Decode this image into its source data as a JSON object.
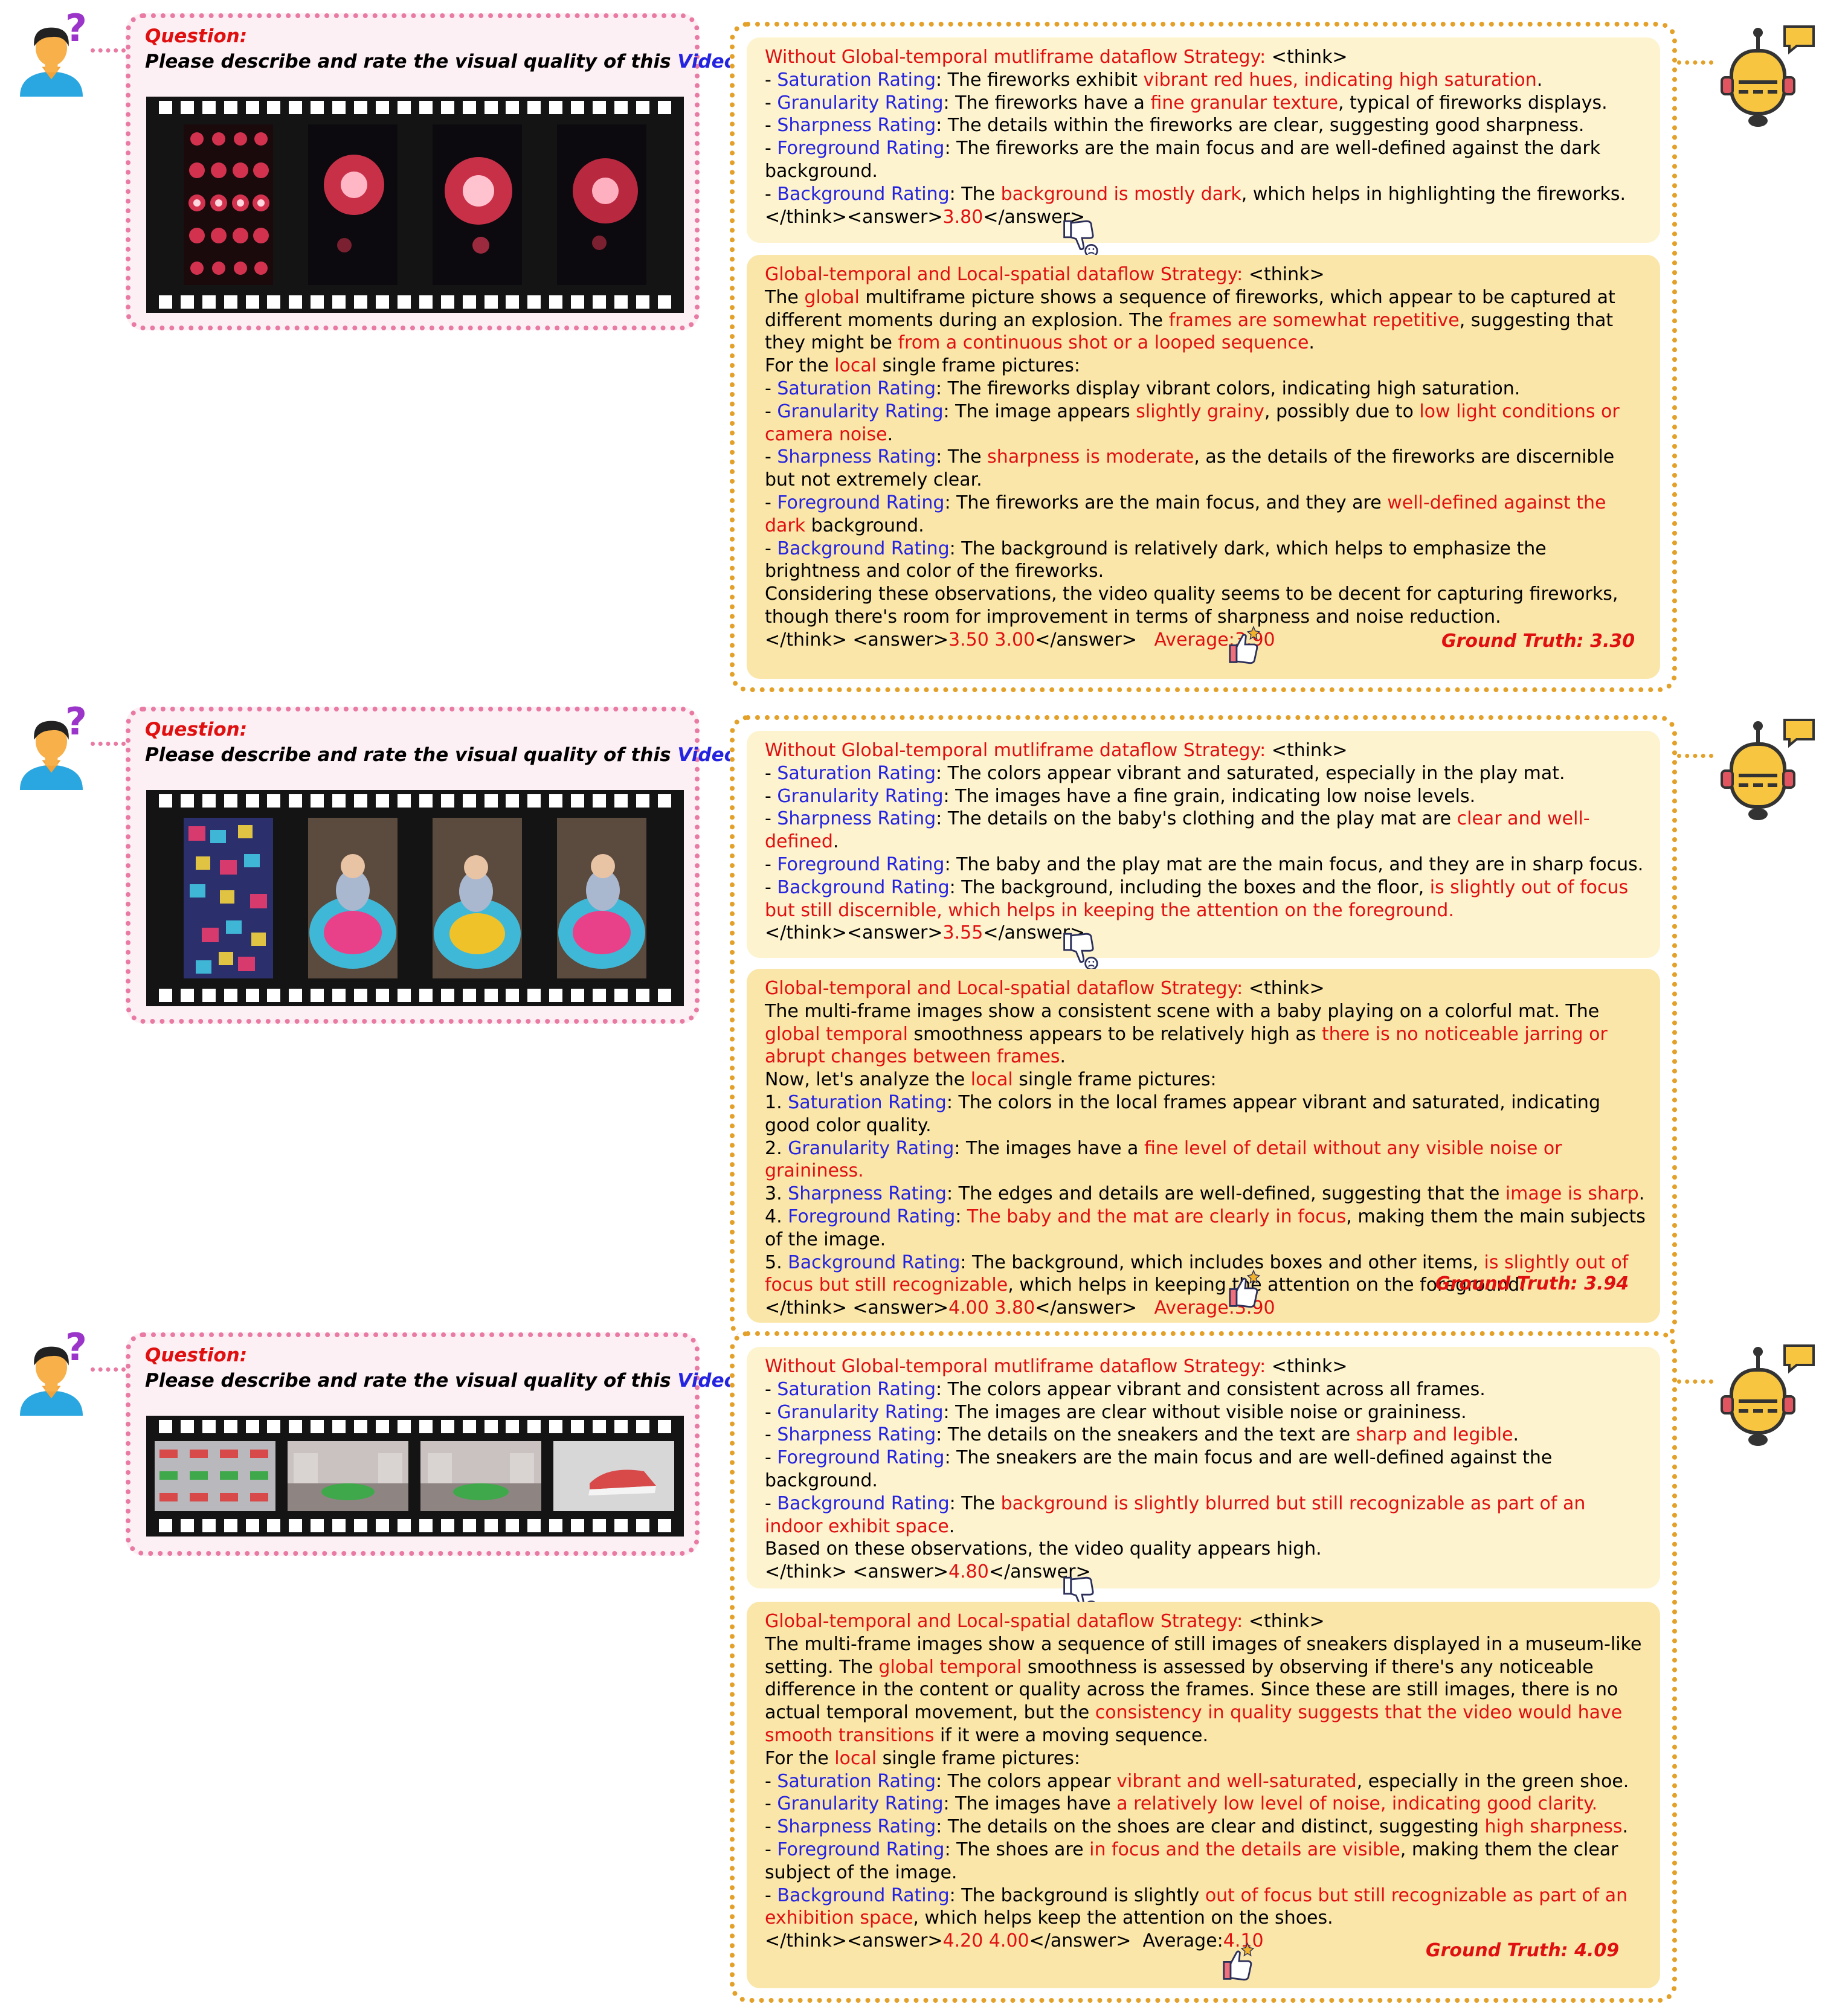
{
  "colors": {
    "pink_border": "#e87aa3",
    "orange_border": "#e3a12a",
    "red_text": "#e01010",
    "blue_text": "#2424e0",
    "box_light": "#fdf3cf",
    "box_dark": "#fbe6a9"
  },
  "icons": {
    "user": "user-avatar-icon",
    "robot": "robot-assistant-icon",
    "thumb_down": "thumbs-down-icon",
    "thumb_up": "thumbs-up-icon"
  },
  "question": {
    "label": "Question:",
    "text": "Please describe and rate the visual quality of this ",
    "video_word": "Video",
    "ellipsis": "..."
  },
  "examples": [
    {
      "frames_desc": [
        "fireworks-grid",
        "fireworks",
        "fireworks",
        "fireworks"
      ],
      "without": {
        "title": "Without Global-temporal mutliframe dataflow Strategy:",
        "think_open": " <think>",
        "answer_open": "</think><answer>",
        "answer_value": "3.80",
        "answer_close": "</answer>"
      },
      "with": {
        "title": "Global-temporal and Local-spatial dataflow Strategy:",
        "think_open": " <think>",
        "answer_open": "</think> <answer>",
        "answer_values": "3.50 3.00",
        "answer_close": "</answer>",
        "average": "Average:3.90",
        "ground_truth": "Ground Truth: 3.30"
      }
    },
    {
      "frames_desc": [
        "baby-grid",
        "baby-playmat",
        "baby-playmat",
        "baby-playmat"
      ],
      "without": {
        "title": "Without Global-temporal mutliframe dataflow Strategy:",
        "think_open": " <think>",
        "answer_open": "</think><answer>",
        "answer_value": "3.55",
        "answer_close": "</answer>"
      },
      "with": {
        "title": "Global-temporal and Local-spatial dataflow Strategy:",
        "think_open": " <think>",
        "answer_open": "</think> <answer>",
        "answer_values": "4.00 3.80",
        "answer_close": "</answer>",
        "average": "Average:3.90",
        "ground_truth": "Ground Truth: 3.94"
      }
    },
    {
      "frames_desc": [
        "sneaker-grid",
        "sneaker-exhibit",
        "sneaker-exhibit",
        "sneaker-closeup"
      ],
      "without": {
        "title": "Without Global-temporal mutliframe dataflow Strategy:",
        "think_open": " <think>",
        "answer_open": "</think> <answer>",
        "answer_value": "4.80",
        "answer_close": "</answer>"
      },
      "with": {
        "title": "Global-temporal and Local-spatial dataflow Strategy:",
        "think_open": " <think>",
        "answer_open": "</think><answer>",
        "answer_values": "4.20 4.00",
        "answer_close": "</answer>",
        "average": "Average:4.10",
        "ground_truth": "Ground Truth: 4.09"
      }
    }
  ]
}
